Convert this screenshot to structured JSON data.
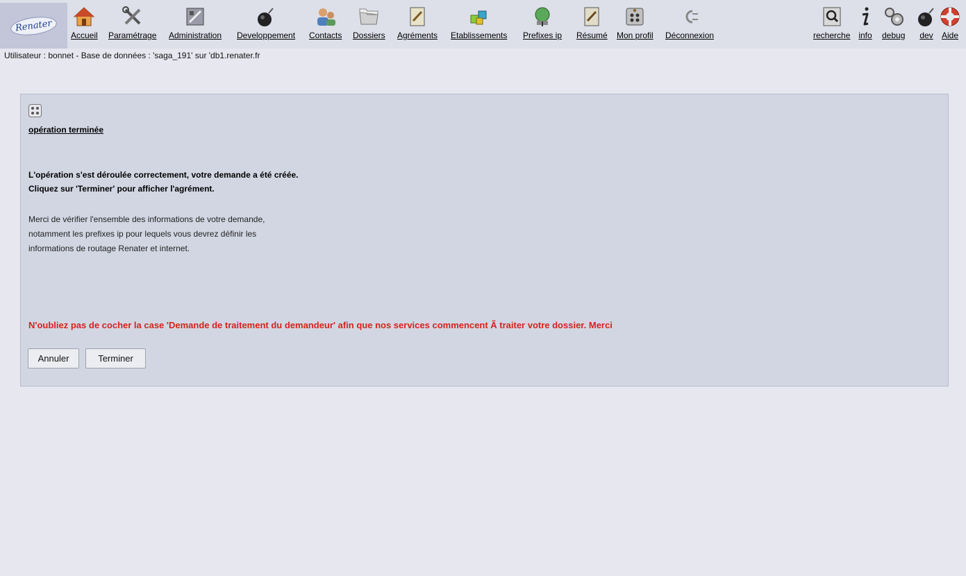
{
  "logo_text": "Renater",
  "nav": {
    "accueil": "Accueil",
    "parametrage": "Paramétrage",
    "administration": "Administration",
    "developpement": "Developpement",
    "contacts": "Contacts",
    "dossiers": "Dossiers",
    "agrements": "Agréments",
    "etablissements": "Etablissements",
    "prefixes": "Prefixes ip",
    "resume": "Résumé",
    "profil": "Mon profil",
    "deconnexion": "Déconnexion",
    "recherche": "recherche",
    "info": "info",
    "debug": "debug",
    "dev": "dev",
    "aide": "Aide"
  },
  "user_line": "Utilisateur : bonnet - Base de données : 'saga_191' sur 'db1.renater.fr",
  "panel": {
    "title": "opération terminée",
    "success_line1": "L'opération s'est déroulée correctement, votre demande a été créée.",
    "success_line2": "Cliquez sur 'Terminer' pour afficher l'agrément.",
    "info_line1": "Merci de vérifier l'ensemble des informations de votre demande,",
    "info_line2": "notamment les prefixes ip pour lequels vous devrez définir les",
    "info_line3": "informations de routage Renater et internet.",
    "warning": "N'oubliez pas de cocher la case 'Demande de traitement du demandeur' afin que nos services commencent Ã  traiter votre dossier. Merci"
  },
  "buttons": {
    "cancel": "Annuler",
    "finish": "Terminer"
  },
  "colors": {
    "warning": "#d9211f",
    "panel_bg": "#d2d6e2",
    "page_bg": "#e6e7ef"
  }
}
